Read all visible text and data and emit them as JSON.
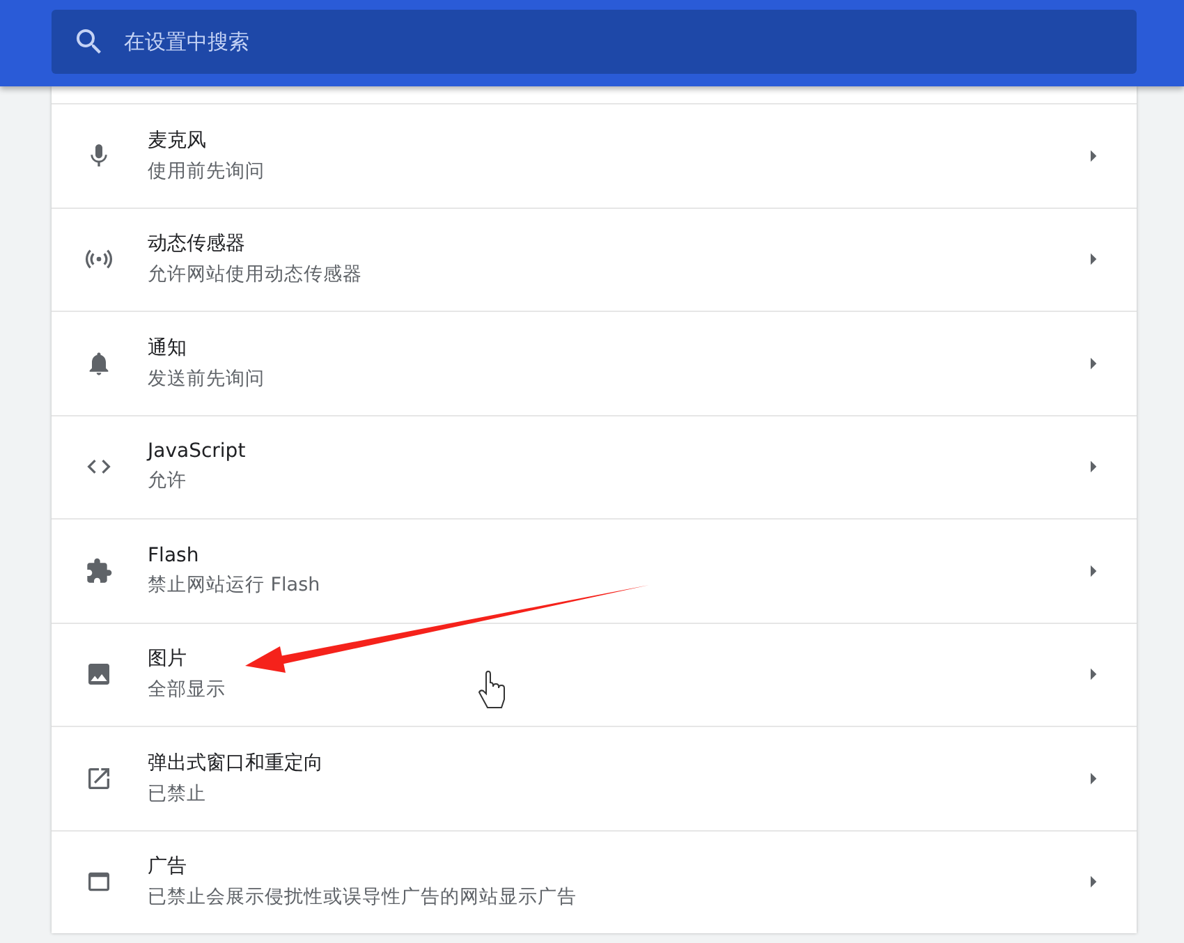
{
  "search": {
    "placeholder": "在设置中搜索"
  },
  "settings": [
    {
      "title": "麦克风",
      "subtitle": "使用前先询问"
    },
    {
      "title": "动态传感器",
      "subtitle": "允许网站使用动态传感器"
    },
    {
      "title": "通知",
      "subtitle": "发送前先询问"
    },
    {
      "title": "JavaScript",
      "subtitle": "允许"
    },
    {
      "title": "Flash",
      "subtitle": "禁止网站运行 Flash"
    },
    {
      "title": "图片",
      "subtitle": "全部显示"
    },
    {
      "title": "弹出式窗口和重定向",
      "subtitle": "已禁止"
    },
    {
      "title": "广告",
      "subtitle": "已禁止会展示侵扰性或误导性广告的网站显示广告"
    }
  ]
}
